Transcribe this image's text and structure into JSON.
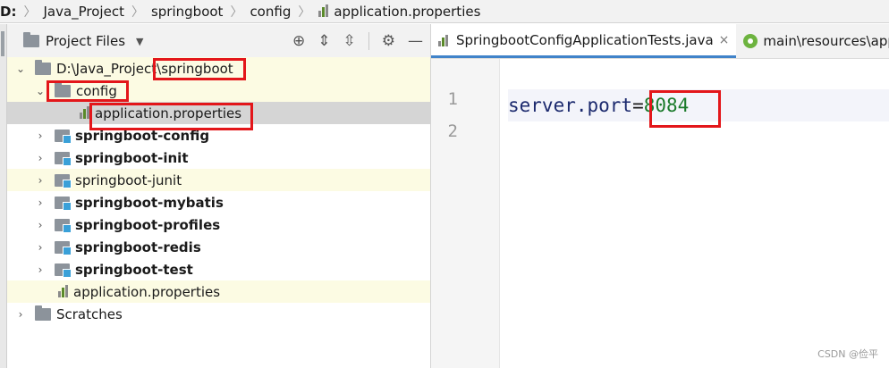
{
  "breadcrumb": {
    "items": [
      "D:",
      "Java_Project",
      "springboot",
      "config",
      "application.properties"
    ]
  },
  "project_panel": {
    "title": "Project Files",
    "tools": [
      "crosshair-icon",
      "expand-icon",
      "collapse-icon",
      "gear-icon",
      "minimize-icon"
    ]
  },
  "tree": {
    "root_label_prefix": "D:\\Java_Project\\",
    "root_label_name": "springboot",
    "config": "config",
    "config_file": "application.properties",
    "modules": [
      "springboot-config",
      "springboot-init",
      "springboot-junit",
      "springboot-mybatis",
      "springboot-profiles",
      "springboot-redis",
      "springboot-test"
    ],
    "root_file": "application.properties",
    "scratches": "Scratches"
  },
  "editor": {
    "tabs": [
      {
        "label": "SpringbootConfigApplicationTests.java",
        "close": "×"
      },
      {
        "label": "main\\resources\\app"
      }
    ],
    "line_numbers": [
      "1",
      "2"
    ],
    "code_key": "server.port",
    "code_eq": "=",
    "code_value": "8084"
  },
  "watermark": "CSDN @俭平",
  "colors": {
    "highlight_box": "#e3161a",
    "selected_row": "#d5d5d5",
    "modified_row": "#fcfbe3",
    "property_value": "#1a7a2a"
  }
}
